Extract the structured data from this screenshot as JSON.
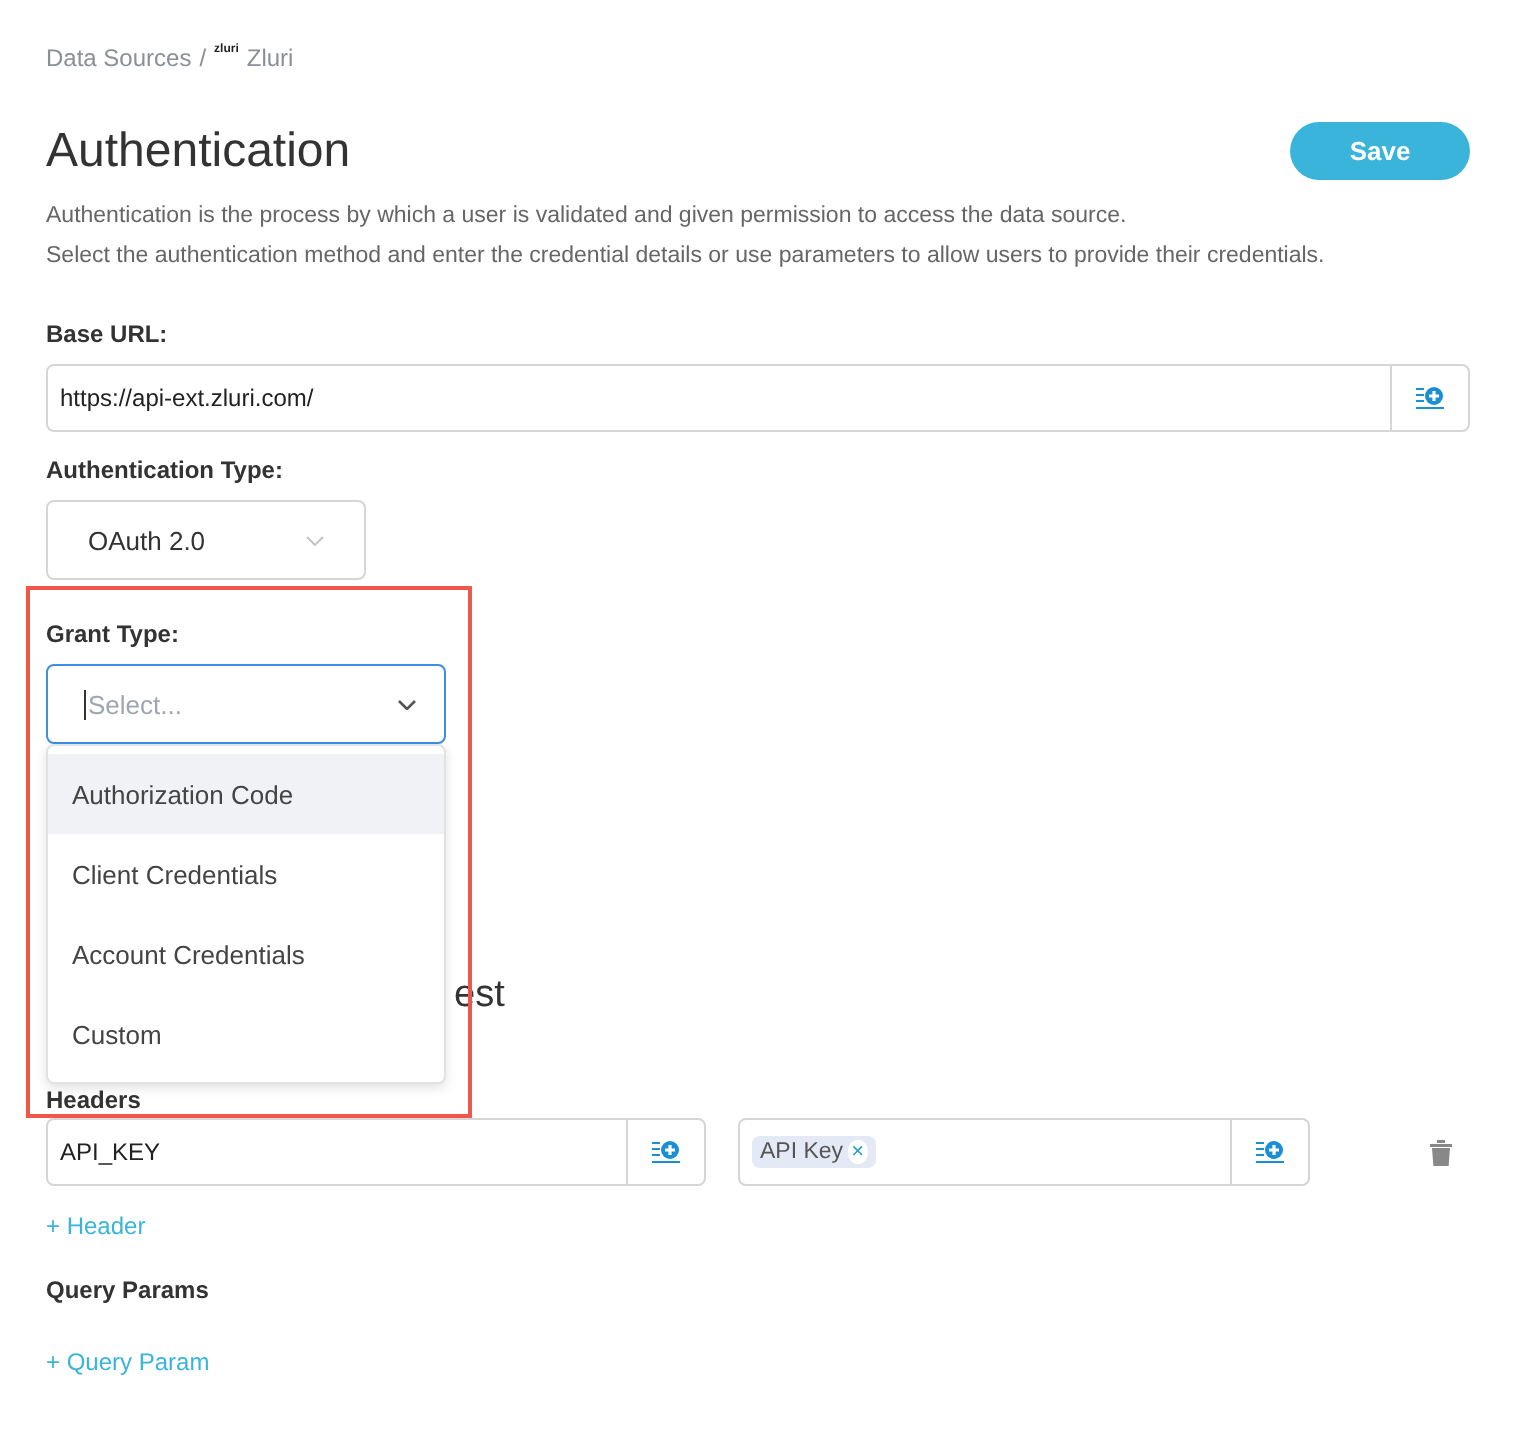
{
  "breadcrumb": {
    "parent": "Data Sources",
    "separator": "/",
    "logo_text": "zluri",
    "current": "Zluri"
  },
  "header": {
    "title": "Authentication",
    "save_button": "Save"
  },
  "description": [
    "Authentication is the process by which a user is validated and given permission to access the data source.",
    "Select the authentication method and enter the credential details or use parameters to allow users to provide their credentials."
  ],
  "base_url": {
    "label": "Base URL:",
    "value": "https://api-ext.zluri.com/"
  },
  "auth_type": {
    "label": "Authentication Type:",
    "value": "OAuth 2.0"
  },
  "grant_type": {
    "label": "Grant Type:",
    "placeholder": "Select...",
    "focused": true,
    "highlight_frame": true,
    "options": [
      {
        "label": "Authorization Code",
        "highlighted": true
      },
      {
        "label": "Client Credentials",
        "highlighted": false
      },
      {
        "label": "Account Credentials",
        "highlighted": false
      },
      {
        "label": "Custom",
        "highlighted": false
      }
    ]
  },
  "section_title_visible_part": "est",
  "headers": {
    "label": "Headers",
    "key": "API_KEY",
    "value_tags": [
      {
        "label": "API Key",
        "remove": "×"
      }
    ],
    "add_link": "+ Header"
  },
  "query_params": {
    "label": "Query Params",
    "add_link": "+ Query Param"
  }
}
